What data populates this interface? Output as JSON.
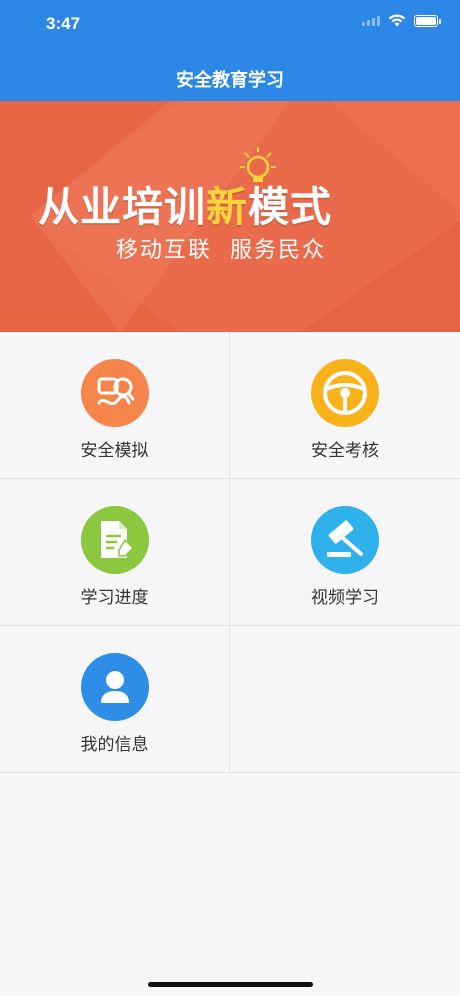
{
  "status_bar": {
    "time": "3:47"
  },
  "header": {
    "title": "安全教育学习"
  },
  "banner": {
    "headline_part1": "从业培训",
    "headline_accent": "新",
    "headline_part2": "模式",
    "subtitle": "移动互联  服务民众",
    "colors": {
      "background": "#ea6b4b",
      "accent": "#ffd33a"
    }
  },
  "menu": {
    "items": [
      {
        "label": "安全模拟",
        "icon": "simulation-icon",
        "color": "#f5854a"
      },
      {
        "label": "安全考核",
        "icon": "steering-wheel-icon",
        "color": "#f8b31a"
      },
      {
        "label": "学习进度",
        "icon": "document-edit-icon",
        "color": "#8cc83f"
      },
      {
        "label": "视频学习",
        "icon": "gavel-icon",
        "color": "#2fb2ec"
      },
      {
        "label": "我的信息",
        "icon": "user-profile-icon",
        "color": "#2e8de6"
      }
    ]
  },
  "colors": {
    "header_bg": "#2d87e6",
    "page_bg": "#f6f6f8"
  }
}
